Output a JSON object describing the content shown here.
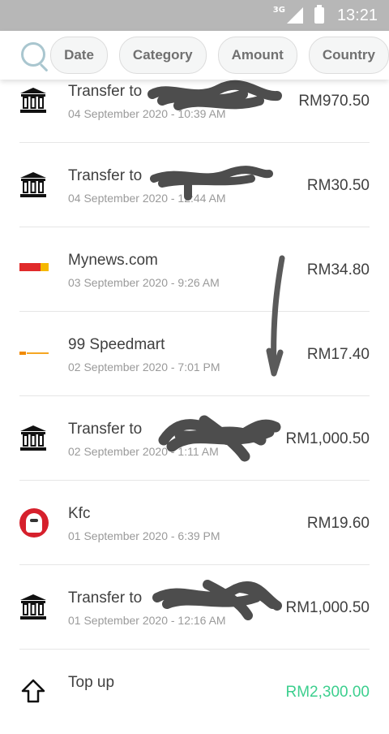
{
  "status_bar": {
    "network": "3G",
    "time": "13:21"
  },
  "filters": {
    "chips": [
      "Date",
      "Category",
      "Amount",
      "Country"
    ]
  },
  "transactions": [
    {
      "title": "Transfer to",
      "date": "04 September 2020 - 10:39 AM",
      "amount": "RM970.50",
      "icon": "bank-icon"
    },
    {
      "title": "Transfer to",
      "date": "04 September 2020 - 12:44 AM",
      "amount": "RM30.50",
      "icon": "bank-icon"
    },
    {
      "title": "Mynews.com",
      "date": "03 September 2020 - 9:26 AM",
      "amount": "RM34.80",
      "icon": "mynews-logo"
    },
    {
      "title": "99 Speedmart",
      "date": "02 September 2020 - 7:01 PM",
      "amount": "RM17.40",
      "icon": "speedmart-logo"
    },
    {
      "title": "Transfer to",
      "date": "02 September 2020 - 1:11 AM",
      "amount": "RM1,000.50",
      "icon": "bank-icon"
    },
    {
      "title": "Kfc",
      "date": "01 September 2020 - 6:39 PM",
      "amount": "RM19.60",
      "icon": "kfc-logo"
    },
    {
      "title": "Transfer to",
      "date": "01 September 2020 - 12:16 AM",
      "amount": "RM1,000.50",
      "icon": "bank-icon"
    },
    {
      "title": "Top up",
      "date": "",
      "amount": "RM2,300.00",
      "icon": "top-up-icon"
    }
  ],
  "colors": {
    "status_bar": "#b7b7b7",
    "accent_green": "#3ccf8e",
    "search_icon": "#a9c6cf"
  }
}
